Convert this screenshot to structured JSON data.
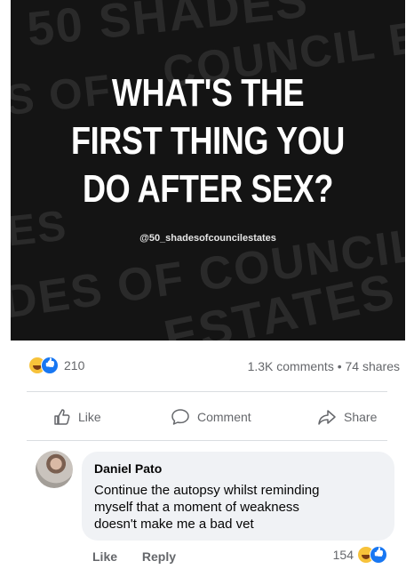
{
  "post_image": {
    "headline_lines": [
      "WHAT'S THE",
      "FIRST THING YOU",
      "DO AFTER SEX?"
    ],
    "handle": "@50_shadesofcouncilestates",
    "background_words": [
      "50 SHADES",
      "COUNCIL ES",
      "S OF",
      "ES",
      "DES OF COUNCIL",
      "ESTATES 50"
    ]
  },
  "stats": {
    "reaction_count": "210",
    "comments_shares": "1.3K comments • 74 shares"
  },
  "actions": {
    "like": "Like",
    "comment": "Comment",
    "share": "Share"
  },
  "comment": {
    "author": "Daniel Pato",
    "lines": [
      "Continue the autopsy whilst reminding",
      "myself that a moment of weakness",
      "doesn't make me a bad vet"
    ],
    "like": "Like",
    "reply": "Reply",
    "reaction_count": "154"
  }
}
